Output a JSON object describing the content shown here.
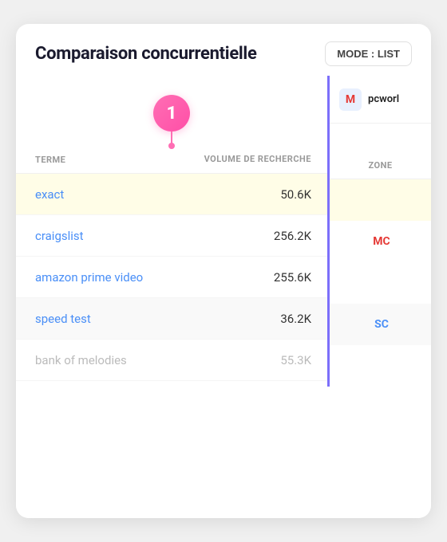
{
  "header": {
    "title": "Comparaison concurrentielle",
    "mode_button": "MODE : LIST"
  },
  "badge": {
    "number": "1"
  },
  "columns": {
    "term_header": "TERME",
    "volume_header": "VOLUME DE RECHERCHE",
    "zone_header": "ZONE"
  },
  "right_panel": {
    "icon": "M",
    "label": "pcworl"
  },
  "rows": [
    {
      "term": "exact",
      "volume": "50.6K",
      "zone": "",
      "zone_class": "zone-empty",
      "highlighted": true,
      "faded": false
    },
    {
      "term": "craigslist",
      "volume": "256.2K",
      "zone": "MC",
      "zone_class": "zone-mc",
      "highlighted": false,
      "faded": false
    },
    {
      "term": "amazon prime video",
      "volume": "255.6K",
      "zone": "",
      "zone_class": "zone-empty",
      "highlighted": false,
      "faded": false
    },
    {
      "term": "speed test",
      "volume": "36.2K",
      "zone": "SC",
      "zone_class": "zone-sc",
      "highlighted": false,
      "faded": false
    },
    {
      "term": "bank of melodies",
      "volume": "55.3K",
      "zone": "",
      "zone_class": "zone-empty",
      "highlighted": false,
      "faded": true
    }
  ]
}
